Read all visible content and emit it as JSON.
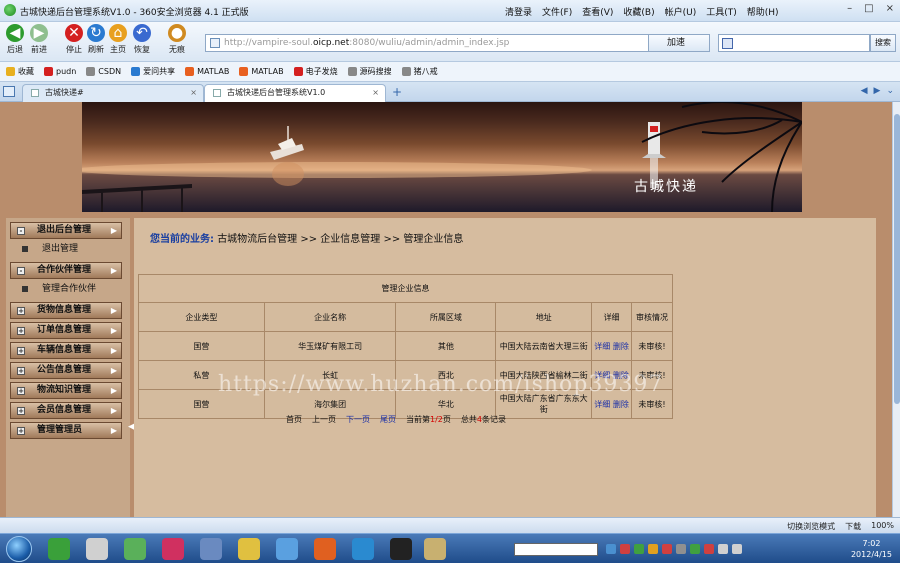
{
  "window": {
    "title": "古城快递后台管理系统V1.0 - 360安全浏览器 4.1 正式版",
    "menus": [
      "清登录",
      "文件(F)",
      "查看(V)",
      "收藏(B)",
      "帐户(U)",
      "工具(T)",
      "帮助(H)"
    ]
  },
  "navbar": {
    "buttons": [
      {
        "label": "后退",
        "color": "#2e9b2e"
      },
      {
        "label": "前进",
        "color": "#8fbf8f"
      },
      {
        "label": "停止",
        "color": "#d42020"
      },
      {
        "label": "刷新",
        "color": "#2a7ad0"
      },
      {
        "label": "主页",
        "color": "#e8a020"
      },
      {
        "label": "恢复",
        "color": "#3a6ad0"
      },
      {
        "label": "无痕",
        "color": "#d08a20"
      }
    ],
    "address_prefix": "http://vampire-soul.",
    "address_domain": "oicp.net",
    "address_suffix": ":8080/wuliu/admin/admin_index.jsp",
    "speed_label": "加速",
    "search_button": "搜索"
  },
  "bookmarks": [
    {
      "label": "收藏",
      "color": "#e8b020"
    },
    {
      "label": "pudn",
      "color": "#d42020"
    },
    {
      "label": "CSDN",
      "color": "#888888"
    },
    {
      "label": "爱问共享",
      "color": "#2a7ad0"
    },
    {
      "label": "MATLAB",
      "color": "#e86020"
    },
    {
      "label": "MATLAB",
      "color": "#e86020"
    },
    {
      "label": "电子发烧",
      "color": "#d42020"
    },
    {
      "label": "源码搜搜",
      "color": "#888888"
    },
    {
      "label": "猪八戒",
      "color": "#888888"
    }
  ],
  "tabs": [
    {
      "label": "古城快递#"
    },
    {
      "label": "古城快递后台管理系统V1.0"
    }
  ],
  "banner": {
    "logo_text": "古城快递"
  },
  "sidebar": {
    "groups": [
      {
        "label": "退出后台管理",
        "sub": "退出管理"
      },
      {
        "label": "合作伙伴管理",
        "sub": "管理合作伙伴"
      },
      {
        "label": "货物信息管理"
      },
      {
        "label": "订单信息管理"
      },
      {
        "label": "车辆信息管理"
      },
      {
        "label": "公告信息管理"
      },
      {
        "label": "物流知识管理"
      },
      {
        "label": "会员信息管理"
      },
      {
        "label": "管理管理员"
      }
    ]
  },
  "breadcrumb": {
    "lead": "您当前的业务:",
    "path": "古城物流后台管理 >> 企业信息管理 >> 管理企业信息"
  },
  "table": {
    "caption": "管理企业信息",
    "headers": [
      "企业类型",
      "企业名称",
      "所属区域",
      "地址",
      "详细",
      "审核情况"
    ],
    "rows": [
      {
        "type": "国营",
        "name": "华玉煤矿有限工司",
        "region": "其他",
        "address": "中国大陆云南省大理三街",
        "detail": "详细",
        "delete": "删除",
        "status": "未审核!"
      },
      {
        "type": "私营",
        "name": "长虹",
        "region": "西北",
        "address": "中国大陆陕西省榆林二街",
        "detail": "详细",
        "delete": "删除",
        "status": "未审核!"
      },
      {
        "type": "国营",
        "name": "海尔集团",
        "region": "华北",
        "address": "中国大陆广东省广东东大街",
        "detail": "详细",
        "delete": "删除",
        "status": "未审核!"
      }
    ]
  },
  "pager": {
    "first": "首页",
    "prev": "上一页",
    "next": "下一页",
    "last": "尾页",
    "current_prefix": "当前第",
    "current_value": "1/2",
    "current_suffix": "页",
    "total_prefix": "总共",
    "total_value": "4",
    "total_suffix": "条记录"
  },
  "watermark": "https://www.huzhan.com/ishop39397",
  "statusbar": {
    "mode": "切换浏览模式",
    "download": "下载",
    "zoom": "100%"
  },
  "taskbar": {
    "time": "7:02",
    "date": "2012/4/15",
    "icons": [
      "#3aa03a",
      "#d0d0d0",
      "#5ab05a",
      "#d03060",
      "#6a8ac0",
      "#e0c040",
      "#5aa0e0",
      "#e06020",
      "#2a8ad0",
      "#222222",
      "#c8b070"
    ]
  }
}
